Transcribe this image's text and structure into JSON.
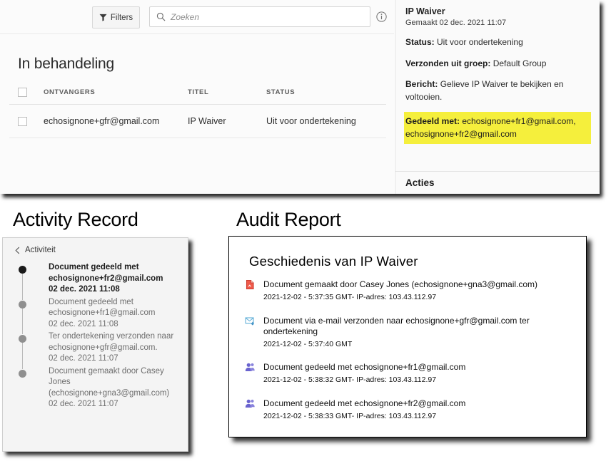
{
  "top_panel": {
    "toolbar": {
      "filters_label": "Filters",
      "filter_icon": "funnel-icon",
      "search_placeholder": "Zoeken",
      "search_value": "",
      "search_icon": "magnifier-icon",
      "info_icon": "info-circle-icon"
    },
    "section_title": "In behandeling",
    "table": {
      "columns": [
        "ONTVANGERS",
        "TITEL",
        "STATUS"
      ],
      "rows": [
        {
          "recipients": "echosignone+gfr@gmail.com",
          "title": "IP Waiver",
          "status": "Uit voor ondertekening",
          "checked": false
        }
      ],
      "header_checkbox_checked": false
    },
    "detail": {
      "doc_title": "IP Waiver",
      "created": "Gemaakt 02 dec. 2021 11:07",
      "status_key": "Status:",
      "status_value": "Uit voor ondertekening",
      "group_key": "Verzonden uit groep:",
      "group_value": "Default Group",
      "message_key": "Bericht:",
      "message_value": "Gelieve IP Waiver te bekijken en voltooien.",
      "shared_key": "Gedeeld met:",
      "shared_value": "echosignone+fr1@gmail.com, echosignone+fr2@gmail.com",
      "shared_highlight_color": "#f5ef3c",
      "actions_label": "Acties"
    }
  },
  "activity_record": {
    "heading": "Activity Record",
    "back_label": "Activiteit",
    "back_icon": "chevron-left-icon",
    "items": [
      {
        "text": "Document gedeeld met echosignone+fr2@gmail.com",
        "time": "02 dec. 2021 11:08",
        "current": true
      },
      {
        "text": "Document gedeeld met echosignone+fr1@gmail.com",
        "time": "02 dec. 2021 11:08",
        "current": false
      },
      {
        "text": "Ter ondertekening verzonden naar echosignone+gfr@gmail.com.",
        "time": "02 dec. 2021 11:07",
        "current": false
      },
      {
        "text": "Document gemaakt door Casey Jones (echosignone+gna3@gmail.com)",
        "time": "02 dec. 2021 11:07",
        "current": false
      }
    ]
  },
  "audit_report": {
    "heading": "Audit Report",
    "title": "Geschiedenis van IP Waiver",
    "events": [
      {
        "icon": "document-created-icon",
        "text": "Document gemaakt door Casey Jones (echosignone+gna3@gmail.com)",
        "meta": "2021-12-02 - 5:37:35 GMT- IP-adres: 103.43.112.97"
      },
      {
        "icon": "email-sent-icon",
        "text": "Document via e-mail verzonden naar echosignone+gfr@gmail.com ter ondertekening",
        "meta": "2021-12-02 - 5:37:40 GMT"
      },
      {
        "icon": "people-shared-icon",
        "text": "Document gedeeld met echosignone+fr1@gmail.com",
        "meta": "2021-12-02 - 5:38:32 GMT- IP-adres: 103.43.112.97"
      },
      {
        "icon": "people-shared-icon",
        "text": "Document gedeeld met echosignone+fr2@gmail.com",
        "meta": "2021-12-02 - 5:38:33 GMT- IP-adres: 103.43.112.97"
      }
    ]
  }
}
